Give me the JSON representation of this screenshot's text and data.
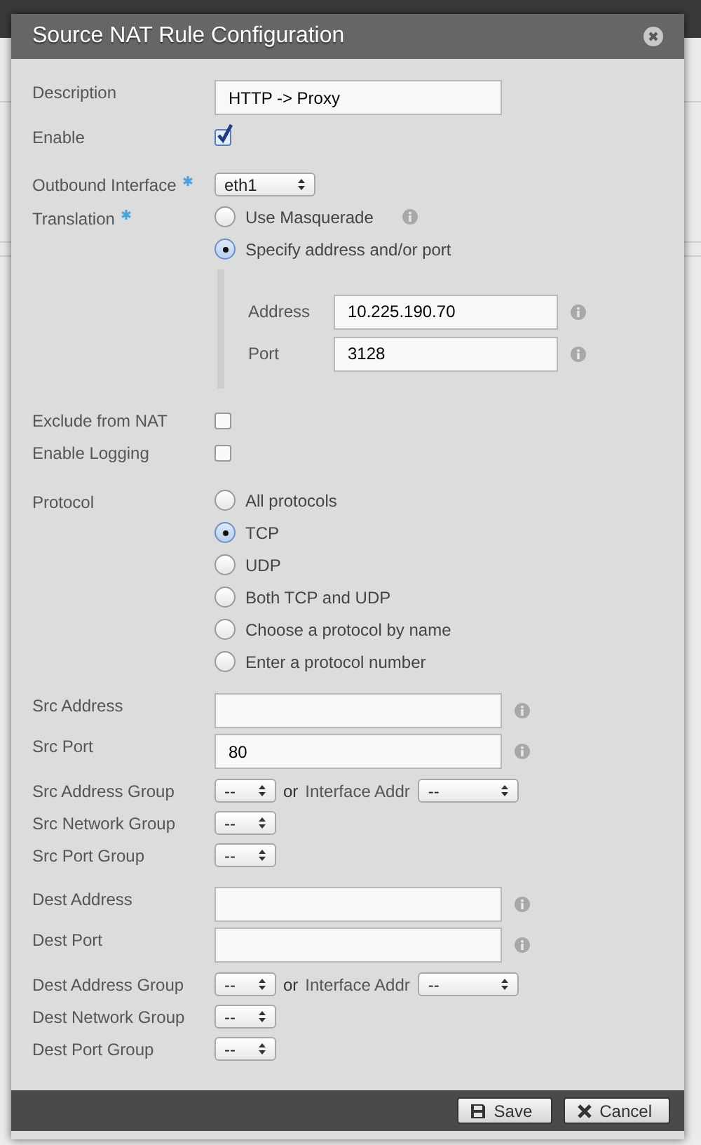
{
  "dialog": {
    "title": "Source NAT Rule Configuration",
    "groups": [
      {
        "rows": [
          {
            "kind": "text",
            "label": "Description",
            "value": "HTTP -> Proxy",
            "info": false
          },
          {
            "kind": "checkbox",
            "label": "Enable",
            "checked": true
          }
        ]
      },
      {
        "rows": [
          {
            "kind": "wide_select",
            "label": "Outbound Interface",
            "required": true,
            "value": "eth1"
          },
          {
            "kind": "radios",
            "label": "Translation",
            "required": true,
            "options": [
              {
                "label": "Use Masquerade",
                "selected": false,
                "info": true
              },
              {
                "label": "Specify address and/or port",
                "selected": true,
                "info": false
              }
            ],
            "sub_fields": [
              {
                "label": "Address",
                "value": "10.225.190.70",
                "info": true
              },
              {
                "label": "Port",
                "value": "3128",
                "info": true
              }
            ]
          }
        ]
      },
      {
        "rows": [
          {
            "kind": "checkbox",
            "label": "Exclude from NAT",
            "checked": false
          },
          {
            "kind": "checkbox",
            "label": "Enable Logging",
            "checked": false
          }
        ]
      },
      {
        "rows": [
          {
            "kind": "radios",
            "label": "Protocol",
            "required": false,
            "options": [
              {
                "label": "All protocols",
                "selected": false,
                "info": false
              },
              {
                "label": "TCP",
                "selected": true,
                "info": false
              },
              {
                "label": "UDP",
                "selected": false,
                "info": false
              },
              {
                "label": "Both TCP and UDP",
                "selected": false,
                "info": false
              },
              {
                "label": "Choose a protocol by name",
                "selected": false,
                "info": false
              },
              {
                "label": "Enter a protocol number",
                "selected": false,
                "info": false
              }
            ]
          }
        ]
      },
      {
        "rows": [
          {
            "kind": "text",
            "label": "Src Address",
            "value": "",
            "info": true
          },
          {
            "kind": "text",
            "label": "Src Port",
            "value": "80",
            "info": true
          },
          {
            "kind": "select_pair",
            "label": "Src Address Group",
            "value": "--",
            "joiner": "or",
            "second_label": "Interface Addr",
            "second_value": "--"
          },
          {
            "kind": "select",
            "label": "Src Network Group",
            "required": false,
            "value": "--"
          },
          {
            "kind": "select",
            "label": "Src Port Group",
            "required": false,
            "value": "--"
          }
        ]
      },
      {
        "rows": [
          {
            "kind": "text",
            "label": "Dest Address",
            "value": "",
            "info": true
          },
          {
            "kind": "text",
            "label": "Dest Port",
            "value": "",
            "info": true
          },
          {
            "kind": "select_pair",
            "label": "Dest Address Group",
            "value": "--",
            "joiner": "or",
            "second_label": "Interface Addr",
            "second_value": "--"
          },
          {
            "kind": "select",
            "label": "Dest Network Group",
            "required": false,
            "value": "--"
          },
          {
            "kind": "select",
            "label": "Dest Port Group",
            "required": false,
            "value": "--"
          }
        ]
      }
    ],
    "buttons": [
      {
        "kind": "save",
        "label": "Save"
      },
      {
        "kind": "cancel",
        "label": "Cancel"
      }
    ]
  }
}
